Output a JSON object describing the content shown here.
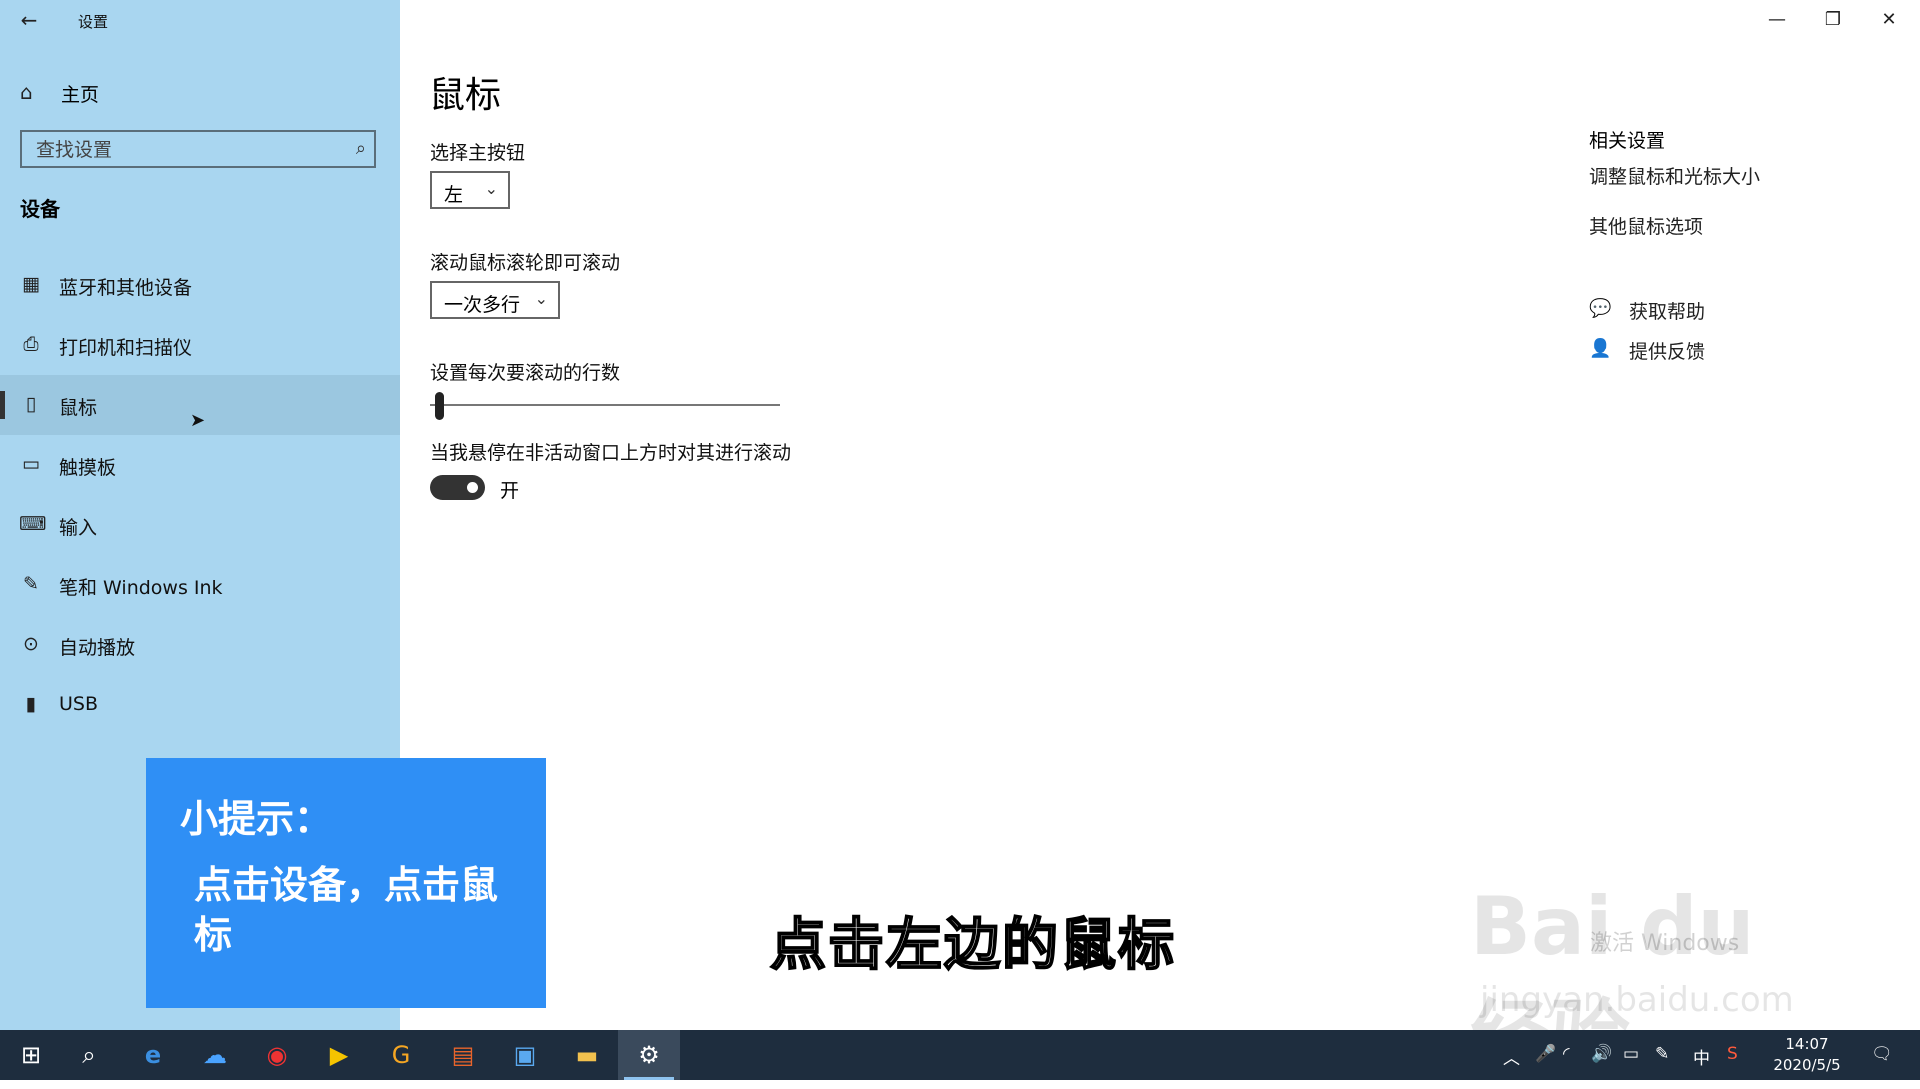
{
  "window": {
    "app_title": "设置",
    "back_icon": "back-arrow-icon",
    "minimize_glyph": "—",
    "maximize_glyph": "❐",
    "close_glyph": "✕"
  },
  "sidebar": {
    "home_label": "主页",
    "search_placeholder": "查找设置",
    "section_title": "设备",
    "items": [
      {
        "label": "蓝牙和其他设备",
        "icon": "bluetooth-devices-icon",
        "glyph": "▦"
      },
      {
        "label": "打印机和扫描仪",
        "icon": "printer-icon",
        "glyph": "⎙"
      },
      {
        "label": "鼠标",
        "icon": "mouse-icon",
        "glyph": "▯",
        "selected": true
      },
      {
        "label": "触摸板",
        "icon": "touchpad-icon",
        "glyph": "▭"
      },
      {
        "label": "输入",
        "icon": "keyboard-icon",
        "glyph": "⌨"
      },
      {
        "label": "笔和 Windows Ink",
        "icon": "pen-icon",
        "glyph": "✎"
      },
      {
        "label": "自动播放",
        "icon": "autoplay-icon",
        "glyph": "⊙"
      },
      {
        "label": "USB",
        "icon": "usb-icon",
        "glyph": "▮"
      }
    ]
  },
  "main": {
    "page_title": "鼠标",
    "primary_button": {
      "label": "选择主按钮",
      "value": "左"
    },
    "scroll_wheel": {
      "label": "滚动鼠标滚轮即可滚动",
      "value": "一次多行"
    },
    "scroll_lines": {
      "label": "设置每次要滚动的行数",
      "value": 0.02
    },
    "inactive_scroll": {
      "label": "当我悬停在非活动窗口上方时对其进行滚动",
      "state_label": "开",
      "on": true
    }
  },
  "related": {
    "title": "相关设置",
    "links": [
      "调整鼠标和光标大小",
      "其他鼠标选项"
    ],
    "help_label": "获取帮助",
    "feedback_label": "提供反馈"
  },
  "overlay": {
    "tip_title": "小提示：",
    "tip_body": "点击设备，点击鼠标",
    "caption": "点击左边的鼠标",
    "watermark_main": "Bai du 经验",
    "watermark_sub": "jingyan.baidu.com",
    "activate_text": "激活 Windows"
  },
  "taskbar": {
    "apps": [
      "start-icon",
      "search-icon",
      "edge-icon",
      "baidu-netdisk-icon",
      "netease-music-icon",
      "tencent-video-icon",
      "grammarly-icon",
      "powerpoint-icon",
      "store-icon",
      "file-explorer-icon",
      "settings-icon"
    ],
    "ime_label": "中",
    "time": "14:07",
    "date": "2020/5/5"
  },
  "colors": {
    "sidebar_bg": "#a9d6f0",
    "tip_bg": "#2f8ff5",
    "taskbar_bg": "#1e2d3e"
  }
}
